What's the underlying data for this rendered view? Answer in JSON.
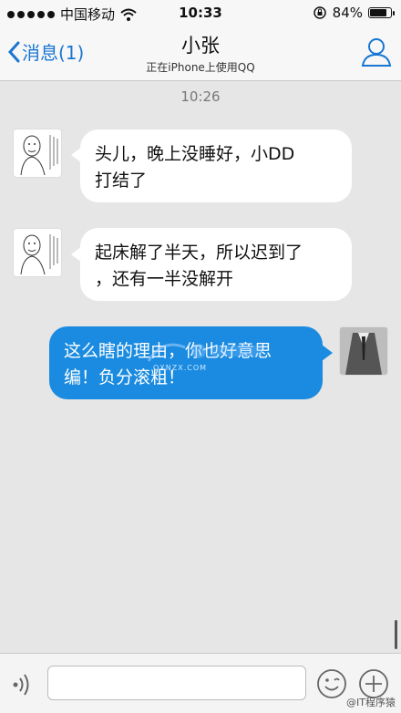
{
  "status_bar": {
    "carrier": "中国移动",
    "time": "10:33",
    "battery": "84%",
    "battery_level": 0.84
  },
  "nav": {
    "back_label": "消息(1)",
    "title": "小张",
    "subtitle": "正在iPhone上使用QQ"
  },
  "chat": {
    "timestamp": "10:26",
    "messages": [
      {
        "direction": "incoming",
        "line1": "头儿，晚上没睡好，小DD",
        "line2": "打结了"
      },
      {
        "direction": "incoming",
        "line1": "起床解了半天，所以迟到了",
        "line2": "，还有一半没解开"
      },
      {
        "direction": "outgoing",
        "line1": "这么瞎的理由，你也好意思",
        "line2": "编！负分滚粗！"
      }
    ]
  },
  "watermark": {
    "domain": "QXNZX.COM"
  },
  "credit": "@IT程序猿",
  "colors": {
    "accent": "#1976d2",
    "outgoing_bubble": "#1a8be0",
    "background": "#e6e6e6"
  }
}
